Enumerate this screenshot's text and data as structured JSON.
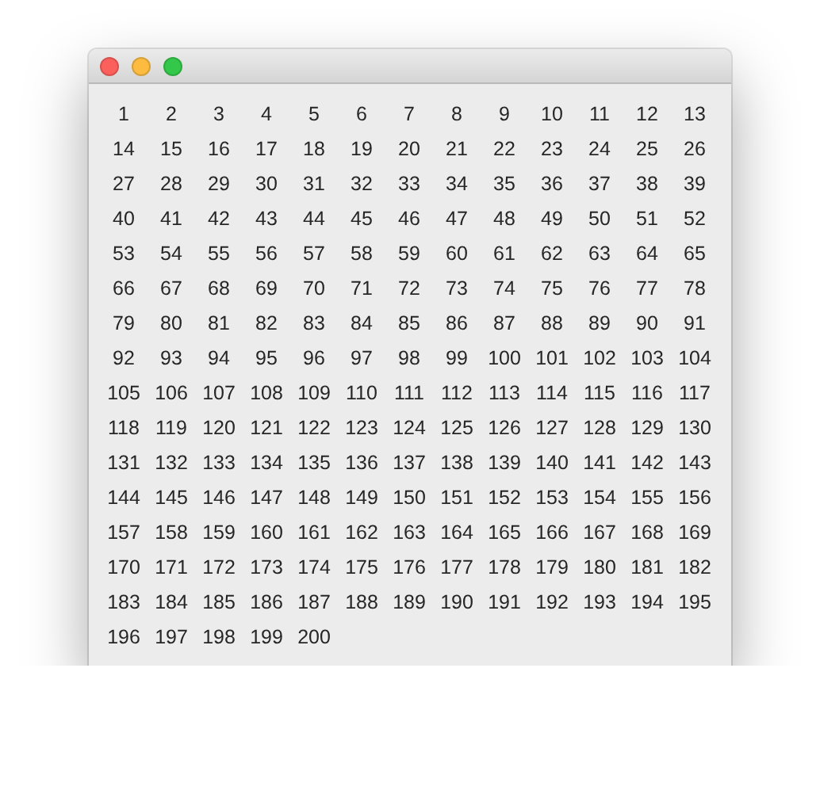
{
  "window": {
    "buttons": [
      {
        "kind": "close"
      },
      {
        "kind": "minimize"
      },
      {
        "kind": "zoom"
      }
    ]
  },
  "numbers": [
    "1",
    "2",
    "3",
    "4",
    "5",
    "6",
    "7",
    "8",
    "9",
    "10",
    "11",
    "12",
    "13",
    "14",
    "15",
    "16",
    "17",
    "18",
    "19",
    "20",
    "21",
    "22",
    "23",
    "24",
    "25",
    "26",
    "27",
    "28",
    "29",
    "30",
    "31",
    "32",
    "33",
    "34",
    "35",
    "36",
    "37",
    "38",
    "39",
    "40",
    "41",
    "42",
    "43",
    "44",
    "45",
    "46",
    "47",
    "48",
    "49",
    "50",
    "51",
    "52",
    "53",
    "54",
    "55",
    "56",
    "57",
    "58",
    "59",
    "60",
    "61",
    "62",
    "63",
    "64",
    "65",
    "66",
    "67",
    "68",
    "69",
    "70",
    "71",
    "72",
    "73",
    "74",
    "75",
    "76",
    "77",
    "78",
    "79",
    "80",
    "81",
    "82",
    "83",
    "84",
    "85",
    "86",
    "87",
    "88",
    "89",
    "90",
    "91",
    "92",
    "93",
    "94",
    "95",
    "96",
    "97",
    "98",
    "99",
    "100",
    "101",
    "102",
    "103",
    "104",
    "105",
    "106",
    "107",
    "108",
    "109",
    "110",
    "111",
    "112",
    "113",
    "114",
    "115",
    "116",
    "117",
    "118",
    "119",
    "120",
    "121",
    "122",
    "123",
    "124",
    "125",
    "126",
    "127",
    "128",
    "129",
    "130",
    "131",
    "132",
    "133",
    "134",
    "135",
    "136",
    "137",
    "138",
    "139",
    "140",
    "141",
    "142",
    "143",
    "144",
    "145",
    "146",
    "147",
    "148",
    "149",
    "150",
    "151",
    "152",
    "153",
    "154",
    "155",
    "156",
    "157",
    "158",
    "159",
    "160",
    "161",
    "162",
    "163",
    "164",
    "165",
    "166",
    "167",
    "168",
    "169",
    "170",
    "171",
    "172",
    "173",
    "174",
    "175",
    "176",
    "177",
    "178",
    "179",
    "180",
    "181",
    "182",
    "183",
    "184",
    "185",
    "186",
    "187",
    "188",
    "189",
    "190",
    "191",
    "192",
    "193",
    "194",
    "195",
    "196",
    "197",
    "198",
    "199",
    "200"
  ]
}
